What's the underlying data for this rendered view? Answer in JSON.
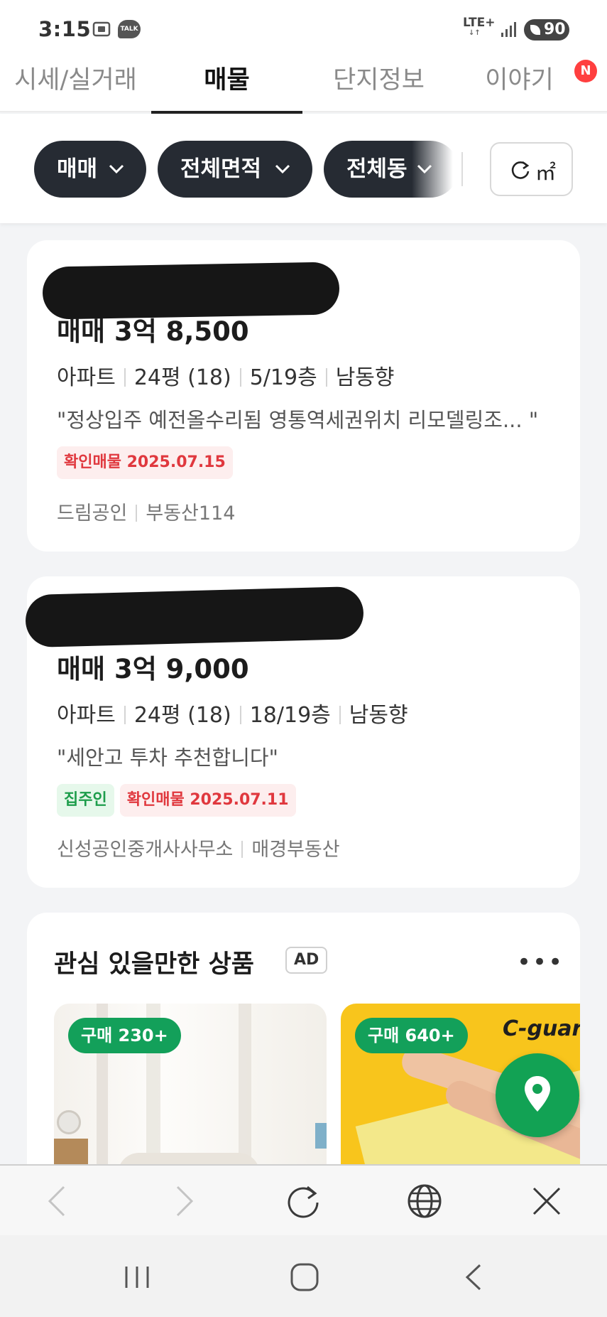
{
  "status": {
    "time": "3:15",
    "talk": "TALK",
    "network": "LTE+",
    "battery": "90"
  },
  "tabs": [
    {
      "label": "시세/실거래",
      "active": false
    },
    {
      "label": "매물",
      "active": true
    },
    {
      "label": "단지정보",
      "active": false
    },
    {
      "label": "이야기",
      "active": false,
      "badge": "N"
    }
  ],
  "filters": {
    "chips": [
      "매매",
      "전체면적",
      "전체동"
    ],
    "unit": "㎡"
  },
  "listings": [
    {
      "price": "매매 3억 8,500",
      "type": "아파트",
      "area": "24평 (18)",
      "floor": "5/19층",
      "direction": "남동향",
      "description": "\"정상입주 예전올수리됨 영통역세권위치 리모델링조...  \"",
      "badges": [
        {
          "kind": "confirm",
          "label": "확인매물 2025.07.15"
        }
      ],
      "agencies": [
        "드림공인",
        "부동산114"
      ]
    },
    {
      "price": "매매 3억 9,000",
      "type": "아파트",
      "area": "24평 (18)",
      "floor": "18/19층",
      "direction": "남동향",
      "description": "\"세안고 투차 추천합니다\"",
      "badges": [
        {
          "kind": "owner",
          "label": "집주인"
        },
        {
          "kind": "confirm",
          "label": "확인매물 2025.07.11"
        }
      ],
      "agencies": [
        "신성공인중개사사무소",
        "매경부동산"
      ]
    }
  ],
  "ad": {
    "title": "관심 있을만한 상품",
    "label": "AD",
    "more": "•••",
    "products": [
      {
        "buy_badge": "구매 230+"
      },
      {
        "buy_badge": "구매 640+",
        "brand": "C-guar"
      }
    ]
  },
  "colors": {
    "chip_bg": "#262b33",
    "accent_green": "#12a254",
    "confirm_red": "#e0383e",
    "notification_red": "#ff3f3f"
  },
  "icons": {
    "fab": "map-pin-icon",
    "browser": [
      "back-icon",
      "forward-icon",
      "refresh-icon",
      "globe-icon",
      "close-icon"
    ],
    "nav": [
      "recent-apps-icon",
      "home-icon",
      "back-nav-icon"
    ]
  }
}
